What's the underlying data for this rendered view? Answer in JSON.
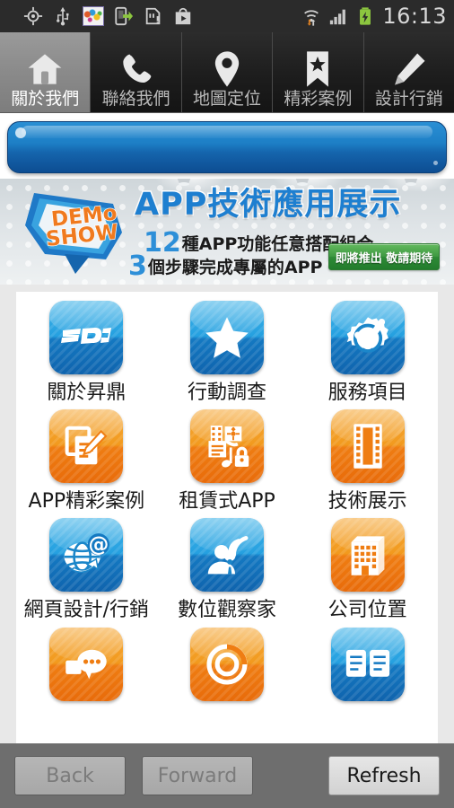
{
  "status_bar": {
    "time": "16:13",
    "left_icons": [
      "gps-icon",
      "usb-icon",
      "photo-thumbnail-icon",
      "phone-transfer-icon",
      "sd-card-alert-icon",
      "play-store-icon"
    ],
    "right_icons": [
      "wifi-data-icon",
      "signal-bars-icon",
      "battery-charging-icon"
    ],
    "battery_color": "#8cc63f"
  },
  "tabs": [
    {
      "label": "關於我們",
      "icon": "home-icon",
      "active": true
    },
    {
      "label": "聯絡我們",
      "icon": "phone-icon",
      "active": false
    },
    {
      "label": "地圖定位",
      "icon": "map-pin-icon",
      "active": false
    },
    {
      "label": "精彩案例",
      "icon": "bookmark-star-icon",
      "active": false
    },
    {
      "label": "設計行銷",
      "icon": "pencil-icon",
      "active": false
    }
  ],
  "banner": {
    "blue_bar_label": "",
    "accent_blue": "#1d7fc6"
  },
  "promo": {
    "logo_line1": "DEMO",
    "logo_line2": "SHOW",
    "title": "APP技術應用展示",
    "line1_number": "12",
    "line1_text": "種APP功能任意搭配組合",
    "line2_number": "3",
    "line2_text": "個步驟完成專屬的APP",
    "cta_label": "即將推出 敬請期待",
    "cta_color": "#3f9a42",
    "title_color": "#1e7fd0"
  },
  "grid": {
    "items": [
      {
        "label": "關於昇鼎",
        "icon": "sdc-logo-icon",
        "color": "blue"
      },
      {
        "label": "行動調查",
        "icon": "star-icon",
        "color": "blue"
      },
      {
        "label": "服務項目",
        "icon": "gear-check-icon",
        "color": "blue"
      },
      {
        "label": "APP精彩案例",
        "icon": "document-pencil-icon",
        "color": "orange"
      },
      {
        "label": "租賃式APP",
        "icon": "media-lock-icon",
        "color": "orange"
      },
      {
        "label": "技術展示",
        "icon": "film-strip-icon",
        "color": "orange"
      },
      {
        "label": "網頁設計/行銷",
        "icon": "globe-at-icon",
        "color": "blue"
      },
      {
        "label": "數位觀察家",
        "icon": "person-wifi-icon",
        "color": "blue"
      },
      {
        "label": "公司位置",
        "icon": "building-icon",
        "color": "orange"
      },
      {
        "label": "",
        "icon": "chat-bubble-icon",
        "color": "orange"
      },
      {
        "label": "",
        "icon": "circle-spiral-icon",
        "color": "orange"
      },
      {
        "label": "",
        "icon": "book-open-icon",
        "color": "blue"
      }
    ],
    "icon_blue": "#25a0e0",
    "icon_orange": "#f29a1e"
  },
  "bottom_bar": {
    "back_label": "Back",
    "forward_label": "Forward",
    "refresh_label": "Refresh",
    "back_enabled": false,
    "forward_enabled": false,
    "refresh_enabled": true
  }
}
